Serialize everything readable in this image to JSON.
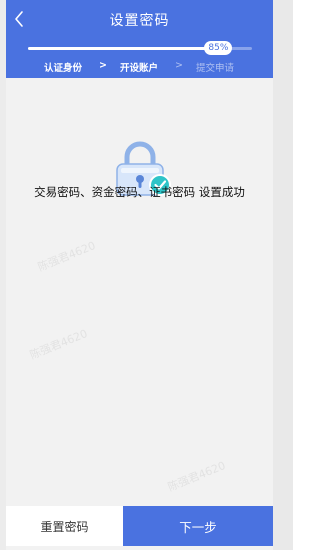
{
  "header": {
    "title": "设置密码",
    "progress_percent": 85,
    "progress_label": "85%",
    "steps": [
      {
        "label": "认证身份",
        "state": "done"
      },
      {
        "label": "开设账户",
        "state": "done"
      },
      {
        "label": "提交申请",
        "state": "pending"
      }
    ],
    "separator": ">"
  },
  "main": {
    "success_message": "交易密码、资金密码、证书密码 设置成功",
    "watermark_text": "陈强君4620"
  },
  "footer": {
    "reset_label": "重置密码",
    "next_label": "下一步"
  },
  "colors": {
    "primary": "#4a72e0",
    "success": "#2ec4c8",
    "background": "#f2f2f2"
  }
}
